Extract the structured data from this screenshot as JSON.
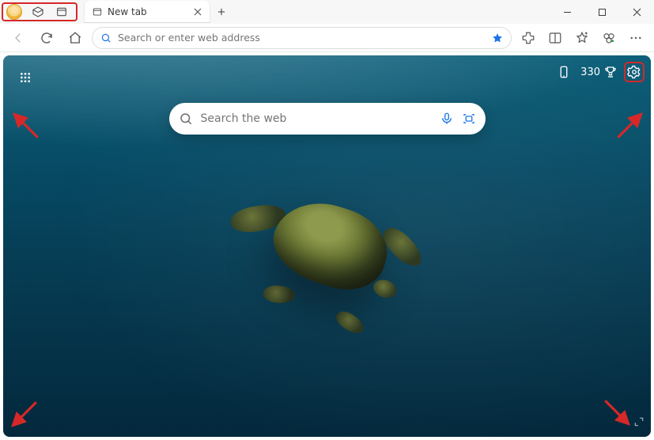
{
  "titlebar": {
    "tab_title": "New tab"
  },
  "toolbar": {
    "omnibox_placeholder": "Search or enter web address"
  },
  "ntp": {
    "search_placeholder": "Search the web",
    "rewards_points": "330"
  },
  "colors": {
    "accent": "#1a73e8",
    "annotation": "#d62828"
  }
}
